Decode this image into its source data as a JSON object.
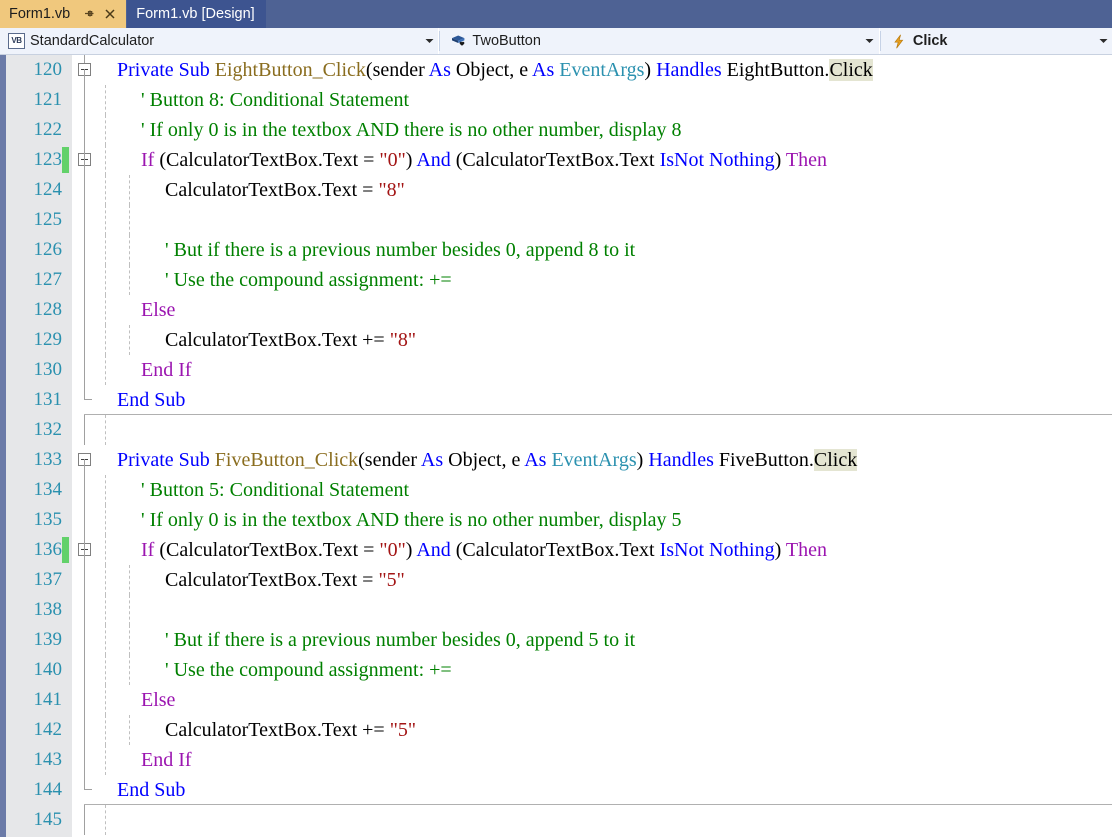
{
  "window": {
    "tabs": [
      {
        "label": "Form1.vb",
        "active": true,
        "icons": [
          "pin-icon",
          "close-icon"
        ]
      },
      {
        "label": "Form1.vb [Design]",
        "active": false,
        "icons": []
      }
    ]
  },
  "navbar": {
    "project_combo": {
      "icon": "vb-file-icon",
      "icon_text": "VB",
      "value": "StandardCalculator"
    },
    "member_combo": {
      "icon": "object-member-icon",
      "value": "TwoButton"
    },
    "event_combo": {
      "icon": "lightning-event-icon",
      "value": "Click",
      "bold": true
    }
  },
  "colors": {
    "tab_active_bg": "#f0c87d",
    "tab_inactive_bg": "#3d5490",
    "tabstrip_bg": "#4e6294",
    "navbar_bg": "#eff3fb",
    "gutter_bg": "#e6e7e9",
    "edge_strip": "#6b7ba8",
    "linenumber": "#2b91af",
    "changebar_green": "#62d16a",
    "keyword_blue": "#0000ff",
    "keyword_purple": "#9b15b0",
    "method_brown": "#8a6d1f",
    "type_teal": "#2b91af",
    "string_red": "#a31515",
    "comment_green": "#008000",
    "highlight_bg": "#e4e5d2"
  },
  "editor": {
    "first_line": 120,
    "last_line": 145,
    "lines": [
      {
        "n": 120,
        "indent": 0,
        "fold": "open",
        "change": false,
        "tokens": [
          {
            "t": "Private Sub ",
            "c": "kw"
          },
          {
            "t": "EightButton_Click",
            "c": "mth"
          },
          {
            "t": "(sender ",
            "c": "pln"
          },
          {
            "t": "As ",
            "c": "kw"
          },
          {
            "t": "Object",
            "c": "pln"
          },
          {
            "t": ", e ",
            "c": "pln"
          },
          {
            "t": "As ",
            "c": "kw"
          },
          {
            "t": "EventArgs",
            "c": "typ"
          },
          {
            "t": ") ",
            "c": "pln"
          },
          {
            "t": "Handles ",
            "c": "kw"
          },
          {
            "t": "EightButton.",
            "c": "pln"
          },
          {
            "t": "Click",
            "c": "pln hl"
          }
        ]
      },
      {
        "n": 121,
        "indent": 1,
        "fold": "none",
        "change": false,
        "tokens": [
          {
            "t": "' Button 8: Conditional Statement",
            "c": "cmt"
          }
        ]
      },
      {
        "n": 122,
        "indent": 1,
        "fold": "none",
        "change": false,
        "tokens": [
          {
            "t": "' If only 0 is in the textbox AND there is no other number, display 8",
            "c": "cmt"
          }
        ]
      },
      {
        "n": 123,
        "indent": 1,
        "fold": "open",
        "change": true,
        "tokens": [
          {
            "t": "If ",
            "c": "kw2"
          },
          {
            "t": "(CalculatorTextBox.Text = ",
            "c": "pln"
          },
          {
            "t": "\"0\"",
            "c": "str"
          },
          {
            "t": ") ",
            "c": "pln"
          },
          {
            "t": "And ",
            "c": "kw"
          },
          {
            "t": "(CalculatorTextBox.Text ",
            "c": "pln"
          },
          {
            "t": "IsNot Nothing",
            "c": "kw"
          },
          {
            "t": ") ",
            "c": "pln"
          },
          {
            "t": "Then",
            "c": "kw2"
          }
        ]
      },
      {
        "n": 124,
        "indent": 2,
        "fold": "none",
        "change": false,
        "tokens": [
          {
            "t": "CalculatorTextBox.Text = ",
            "c": "pln"
          },
          {
            "t": "\"8\"",
            "c": "str"
          }
        ]
      },
      {
        "n": 125,
        "indent": 2,
        "fold": "none",
        "change": false,
        "tokens": []
      },
      {
        "n": 126,
        "indent": 2,
        "fold": "none",
        "change": false,
        "tokens": [
          {
            "t": "' But if there is a previous number besides 0, append 8 to it",
            "c": "cmt"
          }
        ]
      },
      {
        "n": 127,
        "indent": 2,
        "fold": "none",
        "change": false,
        "tokens": [
          {
            "t": "' Use the compound assignment: +=",
            "c": "cmt"
          }
        ]
      },
      {
        "n": 128,
        "indent": 1,
        "fold": "none",
        "change": false,
        "tokens": [
          {
            "t": "Else",
            "c": "kw2"
          }
        ]
      },
      {
        "n": 129,
        "indent": 2,
        "fold": "none",
        "change": false,
        "tokens": [
          {
            "t": "CalculatorTextBox.Text += ",
            "c": "pln"
          },
          {
            "t": "\"8\"",
            "c": "str"
          }
        ]
      },
      {
        "n": 130,
        "indent": 1,
        "fold": "none",
        "change": false,
        "tokens": [
          {
            "t": "End If",
            "c": "kw2"
          }
        ]
      },
      {
        "n": 131,
        "indent": 0,
        "fold": "end",
        "change": false,
        "tokens": [
          {
            "t": "End Sub",
            "c": "kw"
          }
        ]
      },
      {
        "n": 132,
        "indent": 0,
        "fold": "none",
        "change": false,
        "tokens": []
      },
      {
        "n": 133,
        "indent": 0,
        "fold": "open",
        "change": false,
        "tokens": [
          {
            "t": "Private Sub ",
            "c": "kw"
          },
          {
            "t": "FiveButton_Click",
            "c": "mth"
          },
          {
            "t": "(sender ",
            "c": "pln"
          },
          {
            "t": "As ",
            "c": "kw"
          },
          {
            "t": "Object",
            "c": "pln"
          },
          {
            "t": ", e ",
            "c": "pln"
          },
          {
            "t": "As ",
            "c": "kw"
          },
          {
            "t": "EventArgs",
            "c": "typ"
          },
          {
            "t": ") ",
            "c": "pln"
          },
          {
            "t": "Handles ",
            "c": "kw"
          },
          {
            "t": "FiveButton.",
            "c": "pln"
          },
          {
            "t": "Click",
            "c": "pln hl"
          }
        ]
      },
      {
        "n": 134,
        "indent": 1,
        "fold": "none",
        "change": false,
        "tokens": [
          {
            "t": "' Button 5: Conditional Statement",
            "c": "cmt"
          }
        ]
      },
      {
        "n": 135,
        "indent": 1,
        "fold": "none",
        "change": false,
        "tokens": [
          {
            "t": "' If only 0 is in the textbox AND there is no other number, display 5",
            "c": "cmt"
          }
        ]
      },
      {
        "n": 136,
        "indent": 1,
        "fold": "open",
        "change": true,
        "tokens": [
          {
            "t": "If ",
            "c": "kw2"
          },
          {
            "t": "(CalculatorTextBox.Text = ",
            "c": "pln"
          },
          {
            "t": "\"0\"",
            "c": "str"
          },
          {
            "t": ") ",
            "c": "pln"
          },
          {
            "t": "And ",
            "c": "kw"
          },
          {
            "t": "(CalculatorTextBox.Text ",
            "c": "pln"
          },
          {
            "t": "IsNot Nothing",
            "c": "kw"
          },
          {
            "t": ") ",
            "c": "pln"
          },
          {
            "t": "Then",
            "c": "kw2"
          }
        ]
      },
      {
        "n": 137,
        "indent": 2,
        "fold": "none",
        "change": false,
        "tokens": [
          {
            "t": "CalculatorTextBox.Text = ",
            "c": "pln"
          },
          {
            "t": "\"5\"",
            "c": "str"
          }
        ]
      },
      {
        "n": 138,
        "indent": 2,
        "fold": "none",
        "change": false,
        "tokens": []
      },
      {
        "n": 139,
        "indent": 2,
        "fold": "none",
        "change": false,
        "tokens": [
          {
            "t": "' But if there is a previous number besides 0, append 5 to it",
            "c": "cmt"
          }
        ]
      },
      {
        "n": 140,
        "indent": 2,
        "fold": "none",
        "change": false,
        "tokens": [
          {
            "t": "' Use the compound assignment: +=",
            "c": "cmt"
          }
        ]
      },
      {
        "n": 141,
        "indent": 1,
        "fold": "none",
        "change": false,
        "tokens": [
          {
            "t": "Else",
            "c": "kw2"
          }
        ]
      },
      {
        "n": 142,
        "indent": 2,
        "fold": "none",
        "change": false,
        "tokens": [
          {
            "t": "CalculatorTextBox.Text += ",
            "c": "pln"
          },
          {
            "t": "\"5\"",
            "c": "str"
          }
        ]
      },
      {
        "n": 143,
        "indent": 1,
        "fold": "none",
        "change": false,
        "tokens": [
          {
            "t": "End If",
            "c": "kw2"
          }
        ]
      },
      {
        "n": 144,
        "indent": 0,
        "fold": "end",
        "change": false,
        "tokens": [
          {
            "t": "End Sub",
            "c": "kw"
          }
        ]
      },
      {
        "n": 145,
        "indent": 0,
        "fold": "none",
        "change": false,
        "tokens": []
      }
    ]
  }
}
